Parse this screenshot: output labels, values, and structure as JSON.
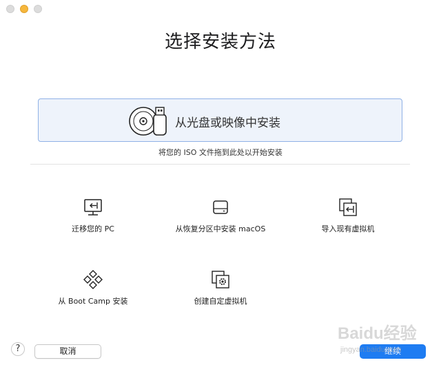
{
  "window": {
    "title": "选择安装方法"
  },
  "drop_zone": {
    "label": "从光盘或映像中安装",
    "hint": "将您的 ISO 文件拖到此处以开始安装",
    "icon": "disc-usb-icon"
  },
  "options": [
    {
      "label": "迁移您的 PC",
      "icon": "monitor-arrow-icon"
    },
    {
      "label": "从恢复分区中安装 macOS",
      "icon": "drive-icon"
    },
    {
      "label": "导入现有虚拟机",
      "icon": "import-vm-icon"
    },
    {
      "label": "从 Boot Camp 安装",
      "icon": "bootcamp-diamond-icon"
    },
    {
      "label": "创建自定虚拟机",
      "icon": "custom-vm-gear-icon"
    }
  ],
  "footer": {
    "help_label": "?",
    "cancel_label": "取消",
    "continue_label": "继续"
  },
  "watermark": {
    "logo": "Baidu经验",
    "sub": "jingyan.baidu.com"
  },
  "colors": {
    "accent": "#1e7cf2",
    "drop_zone_bg": "#eef3fb",
    "drop_zone_border": "#8fb1e6",
    "traffic_yellow": "#f6b73c"
  }
}
